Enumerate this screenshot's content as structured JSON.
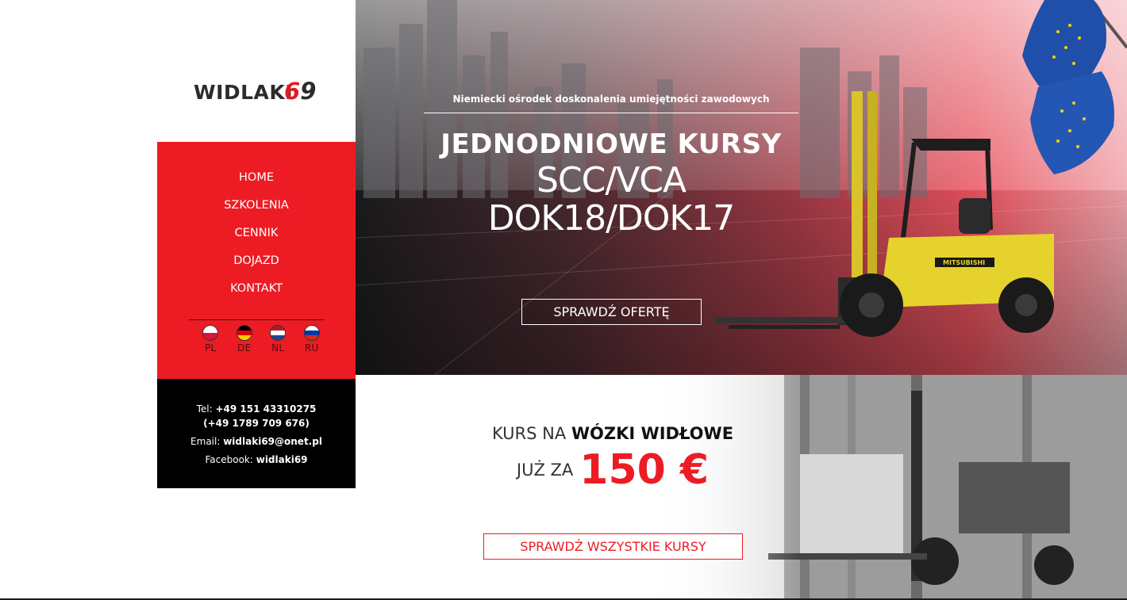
{
  "logo": {
    "text": "WIDLAKI",
    "number_a": "6",
    "number_b": "9"
  },
  "nav": {
    "items": [
      {
        "label": "HOME"
      },
      {
        "label": "SZKOLENIA"
      },
      {
        "label": "CENNIK"
      },
      {
        "label": "DOJAZD"
      },
      {
        "label": "KONTAKT"
      }
    ],
    "languages": [
      {
        "code": "PL",
        "icon": "poland-flag-icon"
      },
      {
        "code": "DE",
        "icon": "germany-flag-icon"
      },
      {
        "code": "NL",
        "icon": "netherlands-flag-icon"
      },
      {
        "code": "RU",
        "icon": "russia-flag-icon"
      }
    ]
  },
  "contact": {
    "tel_label": "Tel:",
    "tel1": "+49 151 43310275",
    "tel2": "(+49 1789 709 676)",
    "email_label": "Email:",
    "email": "widlaki69@onet.pl",
    "facebook_label": "Facebook:",
    "facebook": "widlaki69"
  },
  "hero": {
    "tagline": "Niemiecki ośrodek doskonalenia umiejętności zawodowych",
    "headline": "JEDNODNIOWE KURSY",
    "line2": "SCC/VCA",
    "line3": "DOK18/DOK17",
    "cta_label": "SPRAWDŹ OFERTĘ",
    "forklift_brand": "MITSUBISHI"
  },
  "promo": {
    "line1_pre": "KURS NA ",
    "line1_bold": "WÓZKI WIDŁOWE",
    "line2_pre": "JUŻ ZA",
    "price": "150 €",
    "cta_label": "SPRAWDŹ WSZYSTKIE KURSY"
  },
  "colors": {
    "accent": "#ed1c24",
    "dark": "#000000",
    "text": "#333333"
  }
}
